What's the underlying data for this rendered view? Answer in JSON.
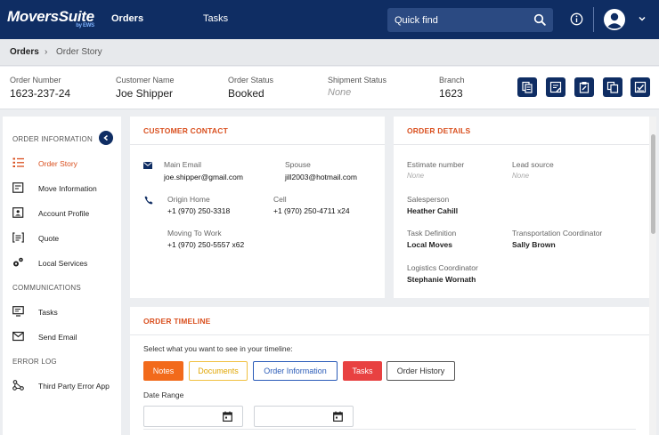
{
  "app": {
    "logo": "MoversSuite",
    "logo_by": "by EWS",
    "nav_tabs": [
      {
        "label": "Orders",
        "active": true
      },
      {
        "label": "Tasks",
        "active": false
      }
    ],
    "quick_find_placeholder": "Quick find"
  },
  "breadcrumb": {
    "root": "Orders",
    "separator": "›",
    "current": "Order Story"
  },
  "summary": {
    "fields": [
      {
        "label": "Order Number",
        "value": "1623-237-24",
        "none": false
      },
      {
        "label": "Customer Name",
        "value": "Joe Shipper",
        "none": false
      },
      {
        "label": "Order Status",
        "value": "Booked",
        "none": false
      },
      {
        "label": "Shipment Status",
        "value": "None",
        "none": true
      },
      {
        "label": "Branch",
        "value": "1623",
        "none": false
      }
    ]
  },
  "sidebar": {
    "section_order": "ORDER INFORMATION",
    "section_comm": "COMMUNICATIONS",
    "section_error": "ERROR LOG",
    "items": [
      {
        "label": "Order Story",
        "icon": "list-icon",
        "active": true
      },
      {
        "label": "Move Information",
        "icon": "document-icon",
        "active": false
      },
      {
        "label": "Account Profile",
        "icon": "profile-card-icon",
        "active": false
      },
      {
        "label": "Quote",
        "icon": "quote-icon",
        "active": false
      },
      {
        "label": "Local Services",
        "icon": "gears-icon",
        "active": false
      },
      {
        "label": "Tasks",
        "icon": "monitor-icon",
        "active": false
      },
      {
        "label": "Send Email",
        "icon": "mail-icon",
        "active": false
      },
      {
        "label": "Third Party Error App",
        "icon": "network-icon",
        "active": false
      }
    ]
  },
  "customer_contact": {
    "title": "CUSTOMER CONTACT",
    "main_email_label": "Main Email",
    "main_email": "joe.shipper@gmail.com",
    "spouse_label": "Spouse",
    "spouse": "jill2003@hotmail.com",
    "origin_home_label": "Origin Home",
    "origin_home": "+1 (970) 250-3318",
    "cell_label": "Cell",
    "cell": "+1 (970) 250-4711 x24",
    "moving_to_work_label": "Moving To Work",
    "moving_to_work": "+1 (970) 250-5557 x62"
  },
  "order_details": {
    "title": "ORDER DETAILS",
    "estimate_label": "Estimate number",
    "estimate": "None",
    "lead_label": "Lead source",
    "lead": "None",
    "salesperson_label": "Salesperson",
    "salesperson": "Heather Cahill",
    "task_def_label": "Task Definition",
    "task_def": "Local Moves",
    "transport_label": "Transportation Coordinator",
    "transport": "Sally Brown",
    "logistics_label": "Logistics Coordinator",
    "logistics": "Stephanie Wornath"
  },
  "timeline": {
    "title": "ORDER TIMELINE",
    "prompt": "Select what you want to see in your timeline:",
    "filters": [
      {
        "label": "Notes",
        "bg": "#f26a1b",
        "fg": "#ffffff",
        "border": "#f26a1b"
      },
      {
        "label": "Documents",
        "bg": "#ffffff",
        "fg": "#e0a500",
        "border": "#f0c040"
      },
      {
        "label": "Order Information",
        "bg": "#ffffff",
        "fg": "#2a5bb8",
        "border": "#2a5bb8"
      },
      {
        "label": "Tasks",
        "bg": "#e84141",
        "fg": "#ffffff",
        "border": "#e84141"
      },
      {
        "label": "Order History",
        "bg": "#ffffff",
        "fg": "#333333",
        "border": "#555555"
      }
    ],
    "date_range_label": "Date Range"
  },
  "colors": {
    "brand": "#0f2d63",
    "accent": "#d94f1e"
  }
}
